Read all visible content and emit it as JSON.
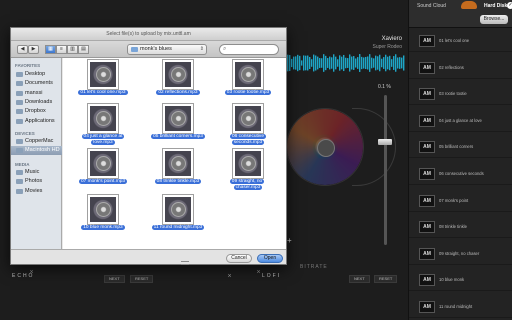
{
  "player": {
    "track_title": "Xaviero",
    "track_artist": "Super Rodeo",
    "slider_value": "0.1 %",
    "bitrate_label": "BITRATE",
    "echo_label": "ECHO",
    "lofi_label": "LOFI",
    "left_next": "NEXT",
    "left_reset": "RESET",
    "right_next": "NEXT",
    "right_reset": "RESET",
    "close_glyph": "×",
    "cursor_glyph": "+"
  },
  "sidebar": {
    "tab_soundcloud": "Sound Cloud",
    "tab_harddisk": "Hard Disk",
    "check_glyph": "✓",
    "browse_label": "Browse...",
    "thumb_label": "AM",
    "items": [
      "01 let's cool one",
      "02 reflections",
      "03 rootie tootie",
      "04 just a glance at love",
      "05 brilliant corners",
      "06 consecutive seconds",
      "07 monk's point",
      "08 trinkle tinkle",
      "09 straight, no chaser",
      "10 blue monk",
      "11 round midnight"
    ]
  },
  "dialog": {
    "title": "Select file(s) to upload by mix.unttl.am",
    "back_glyph": "◀",
    "forward_glyph": "▶",
    "view_icons": [
      "▦",
      "≡",
      "▥",
      "▤"
    ],
    "path_folder": "monk's blues",
    "path_arrows": "⇕",
    "search_glyph": "⌕",
    "sidebar": {
      "favorites_head": "FAVORITES",
      "favorites": [
        "Desktop",
        "Documents",
        "manssi",
        "Downloads",
        "Dropbox",
        "Applications"
      ],
      "devices_head": "DEVICES",
      "devices": [
        "CopperMac",
        "Macintosh HD"
      ],
      "media_head": "MEDIA",
      "media": [
        "Music",
        "Photos",
        "Movies"
      ]
    },
    "files": [
      "01 let's cool one.mp3",
      "02 reflections.mp3",
      "03 rootie tootie.mp3",
      "04 just a glance at love.mp3",
      "05 brilliant corners.mp3",
      "06 consecutive seconds.mp3",
      "07 monk's point.mp3",
      "08 trinkle tinkle.mp3",
      "09 straight, no chaser.mp3",
      "10 blue monk.mp3",
      "11 round midnight.mp3"
    ],
    "cancel_label": "Cancel",
    "open_label": "Open"
  }
}
